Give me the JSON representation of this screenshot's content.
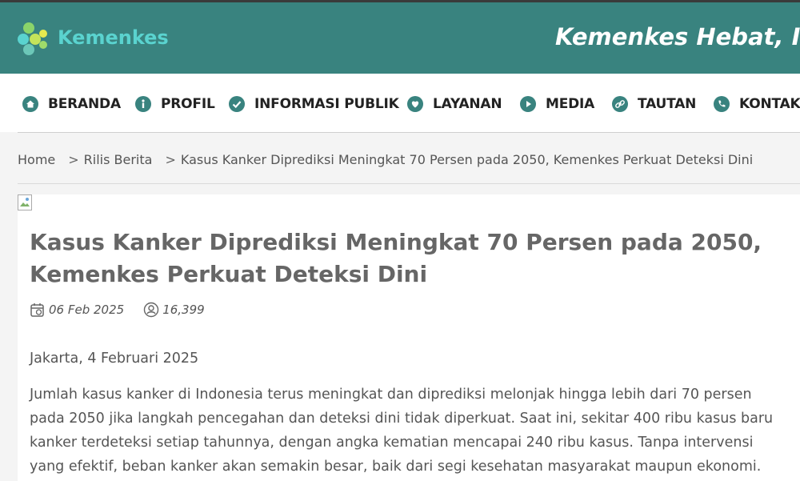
{
  "header": {
    "logo_text": "Kemenkes",
    "tagline": "Kemenkes Hebat, Indonesia Kuat"
  },
  "nav": {
    "items": [
      {
        "label": "BERANDA",
        "icon": "home-icon"
      },
      {
        "label": "PROFIL",
        "icon": "info-icon"
      },
      {
        "label": "INFORMASI PUBLIK",
        "icon": "check-circle-icon"
      },
      {
        "label": "LAYANAN",
        "icon": "heart-icon"
      },
      {
        "label": "MEDIA",
        "icon": "play-icon"
      },
      {
        "label": "TAUTAN",
        "icon": "link-icon"
      },
      {
        "label": "KONTAK",
        "icon": "phone-icon"
      }
    ]
  },
  "breadcrumb": {
    "home": "Home",
    "separator": ">",
    "category": "Rilis Berita",
    "current": "Kasus Kanker Diprediksi Meningkat 70 Persen pada 2050, Kemenkes Perkuat Deteksi Dini"
  },
  "article": {
    "title_line1": "Kasus Kanker Diprediksi Meningkat 70 Persen pada 2050,",
    "title_line2": "Kemenkes Perkuat Deteksi Dini",
    "date": "06 Feb 2025",
    "views": "16,399",
    "paragraph1": "Jakarta, 4 Februari 2025",
    "paragraph2": "Jumlah kasus kanker di Indonesia terus meningkat dan diprediksi melonjak hingga lebih dari 70 persen pada 2050 jika langkah pencegahan dan deteksi dini tidak diperkuat. Saat ini, sekitar 400 ribu kasus baru kanker terdeteksi setiap tahunnya, dengan angka kematian mencapai 240 ribu kasus. Tanpa intervensi yang efektif, beban kanker akan semakin besar, baik dari segi kesehatan masyarakat maupun ekonomi."
  },
  "colors": {
    "header_bg": "#39837f",
    "logo_text": "#5ad3cf",
    "nav_icon": "#39837f"
  }
}
